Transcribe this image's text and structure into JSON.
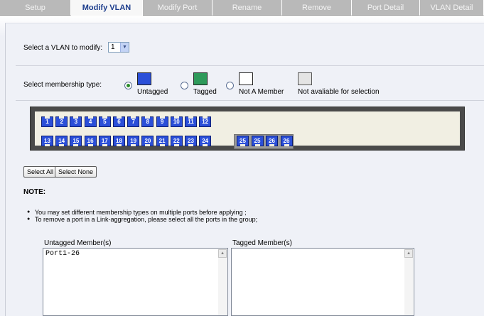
{
  "tabs": [
    {
      "label": "Setup",
      "active": false
    },
    {
      "label": "Modify VLAN",
      "active": true
    },
    {
      "label": "Modify Port",
      "active": false
    },
    {
      "label": "Rename",
      "active": false
    },
    {
      "label": "Remove",
      "active": false
    },
    {
      "label": "Port Detail",
      "active": false
    },
    {
      "label": "VLAN Detail",
      "active": false
    }
  ],
  "vlan_select": {
    "label": "Select a VLAN to modify:",
    "value": "1"
  },
  "membership": {
    "label": "Select membership type:",
    "options": [
      {
        "label": "Untagged",
        "color": "#2b4fd8",
        "checked": true
      },
      {
        "label": "Tagged",
        "color": "#2e9a5a",
        "checked": false
      },
      {
        "label": "Not A Member",
        "color": "#ffffff",
        "checked": false
      },
      {
        "label": "Not avaliable for selection",
        "color": "#e4e4e4",
        "checked": false
      }
    ]
  },
  "ports": {
    "top_row": [
      "1",
      "2",
      "3",
      "4",
      "5",
      "6",
      "7",
      "8",
      "9",
      "10",
      "11",
      "12"
    ],
    "bottom_row": [
      "13",
      "14",
      "15",
      "16",
      "17",
      "18",
      "19",
      "20",
      "21",
      "22",
      "23",
      "24"
    ],
    "sfp": [
      "25",
      "25",
      "26",
      "26"
    ],
    "port_color": "#2b4fd8"
  },
  "buttons": {
    "select_all": "Select All",
    "select_none": "Select None"
  },
  "note": {
    "title": "NOTE:",
    "items": [
      "You may set different membership types on multiple ports before applying ;",
      "To remove a port in a Link-aggregation, please select all the ports in the group;"
    ]
  },
  "members": {
    "untagged_label": "Untagged Member(s)",
    "untagged_value": "Port1-26",
    "tagged_label": "Tagged Member(s)",
    "tagged_value": ""
  }
}
